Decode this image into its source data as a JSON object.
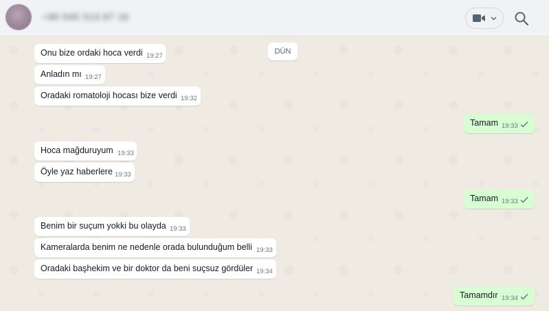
{
  "header": {
    "contact_name": "+90 545 513 87 16"
  },
  "day_separator": "DÜN",
  "messages": [
    {
      "text": "Onu bize ordaki hoca verdi",
      "time": "19:27",
      "direction": "in"
    },
    {
      "text": "Anladın mı",
      "time": "19:27",
      "direction": "in"
    },
    {
      "text": "Oradaki romatoloji hocası bize verdi",
      "time": "19:32",
      "direction": "in"
    },
    {
      "text": "Tamam",
      "time": "19:33",
      "direction": "out"
    },
    {
      "text": "Hoca mağduruyum",
      "time": "19:33",
      "direction": "in"
    },
    {
      "text": "Öyle yaz haberlere",
      "time": "19:33",
      "direction": "in"
    },
    {
      "text": "Tamam",
      "time": "19:33",
      "direction": "out"
    },
    {
      "text": "Benim bir suçum yokki bu olayda",
      "time": "19:33",
      "direction": "in"
    },
    {
      "text": "Kameralarda benim ne nedenle orada bulunduğum belli",
      "time": "19:33",
      "direction": "in"
    },
    {
      "text": "Oradaki başhekim ve bir doktor da beni suçsuz gördüler",
      "time": "19:34",
      "direction": "in"
    },
    {
      "text": "Tamamdır",
      "time": "19:34",
      "direction": "out"
    }
  ],
  "icons": {
    "video": "video-camera-icon",
    "dropdown": "chevron-down-icon",
    "search": "search-icon",
    "status": "single-check-icon"
  },
  "colors": {
    "incoming_bubble": "#ffffff",
    "outgoing_bubble": "#d9fdd3",
    "chat_background": "#efeae2",
    "header_background": "#f0f2f5"
  }
}
